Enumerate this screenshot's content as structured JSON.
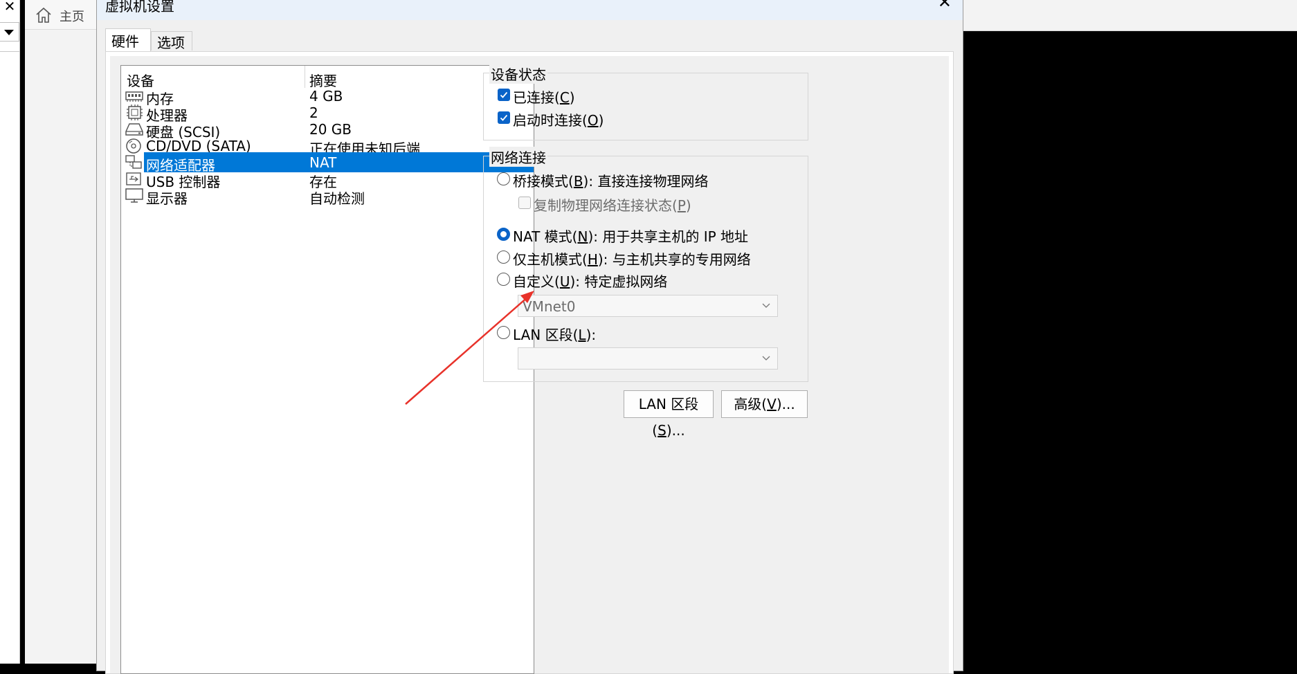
{
  "background": {
    "left_close": "✕",
    "home_tab_label": "主页"
  },
  "dialog": {
    "title": "虚拟机设置",
    "close": "✕",
    "tabs": [
      "硬件",
      "选项"
    ]
  },
  "device_list": {
    "col_device": "设备",
    "col_summary": "摘要",
    "rows": [
      {
        "name": "内存",
        "summary": "4 GB",
        "icon": "memory-icon"
      },
      {
        "name": "处理器",
        "summary": "2",
        "icon": "processor-icon"
      },
      {
        "name": "硬盘 (SCSI)",
        "summary": "20 GB",
        "icon": "harddisk-icon"
      },
      {
        "name": "CD/DVD (SATA)",
        "summary": "正在使用未知后端",
        "icon": "cd-dvd-icon"
      },
      {
        "name": "网络适配器",
        "summary": "NAT",
        "icon": "network-adapter-icon",
        "selected": true
      },
      {
        "name": "USB 控制器",
        "summary": "存在",
        "icon": "usb-icon"
      },
      {
        "name": "显示器",
        "summary": "自动检测",
        "icon": "monitor-icon"
      }
    ]
  },
  "device_status": {
    "title": "设备状态",
    "connected": {
      "pre": "已连接(",
      "key": "C",
      "post": ")",
      "checked": true
    },
    "connect_on_power": {
      "pre": "启动时连接(",
      "key": "O",
      "post": ")",
      "checked": true
    }
  },
  "network": {
    "title": "网络连接",
    "bridged": {
      "pre": "桥接模式(",
      "key": "B",
      "post": "): 直接连接物理网络",
      "selected": false
    },
    "replicate": {
      "pre": "复制物理网络连接状态(",
      "key": "P",
      "post": ")",
      "checked": false
    },
    "nat": {
      "pre": "NAT 模式(",
      "key": "N",
      "post": "): 用于共享主机的 IP 地址",
      "selected": true
    },
    "hostonly": {
      "pre": "仅主机模式(",
      "key": "H",
      "post": "): 与主机共享的专用网络",
      "selected": false
    },
    "custom": {
      "pre": "自定义(",
      "key": "U",
      "post": "): 特定虚拟网络",
      "selected": false
    },
    "custom_value": "VMnet0",
    "lan": {
      "pre": "LAN 区段(",
      "key": "L",
      "post": "):",
      "selected": false
    },
    "lan_value": ""
  },
  "buttons": {
    "lan_segments": {
      "pre": "LAN 区段(",
      "key": "S",
      "post": ")..."
    },
    "advanced": {
      "pre": "高级(",
      "key": "V",
      "post": ")..."
    }
  },
  "colors": {
    "selection": "#0078d7",
    "accent": "#0a63c8",
    "annotation_arrow": "#e8322a"
  }
}
